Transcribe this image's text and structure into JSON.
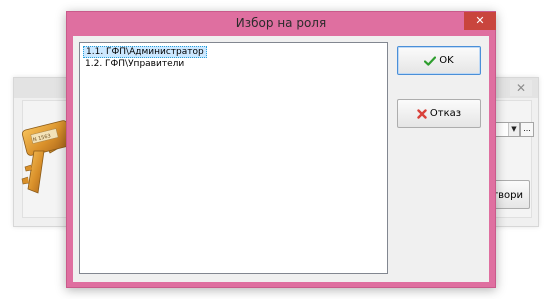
{
  "dialog": {
    "title": "Избор на роля",
    "close_glyph": "✕"
  },
  "roles": [
    {
      "label": "1.1. ГФП\\Администратор",
      "selected": true
    },
    {
      "label": "1.2. ГФП\\Управители",
      "selected": false
    }
  ],
  "buttons": {
    "ok": {
      "label": "OK",
      "icon": "check-icon",
      "icon_color": "#2e9e2e"
    },
    "cancel": {
      "label": "Отказ",
      "icon": "cross-icon",
      "icon_color": "#d9413a"
    }
  },
  "background_window": {
    "close_glyph": "✕",
    "combo_arrow_glyph": "▼",
    "ellipsis_label": "...",
    "button_label": "твори",
    "key_tag_text": "N 1563"
  },
  "colors": {
    "dialog_frame": "#df6fa0",
    "close_button": "#c9453d",
    "selection": "#cce8ff"
  }
}
